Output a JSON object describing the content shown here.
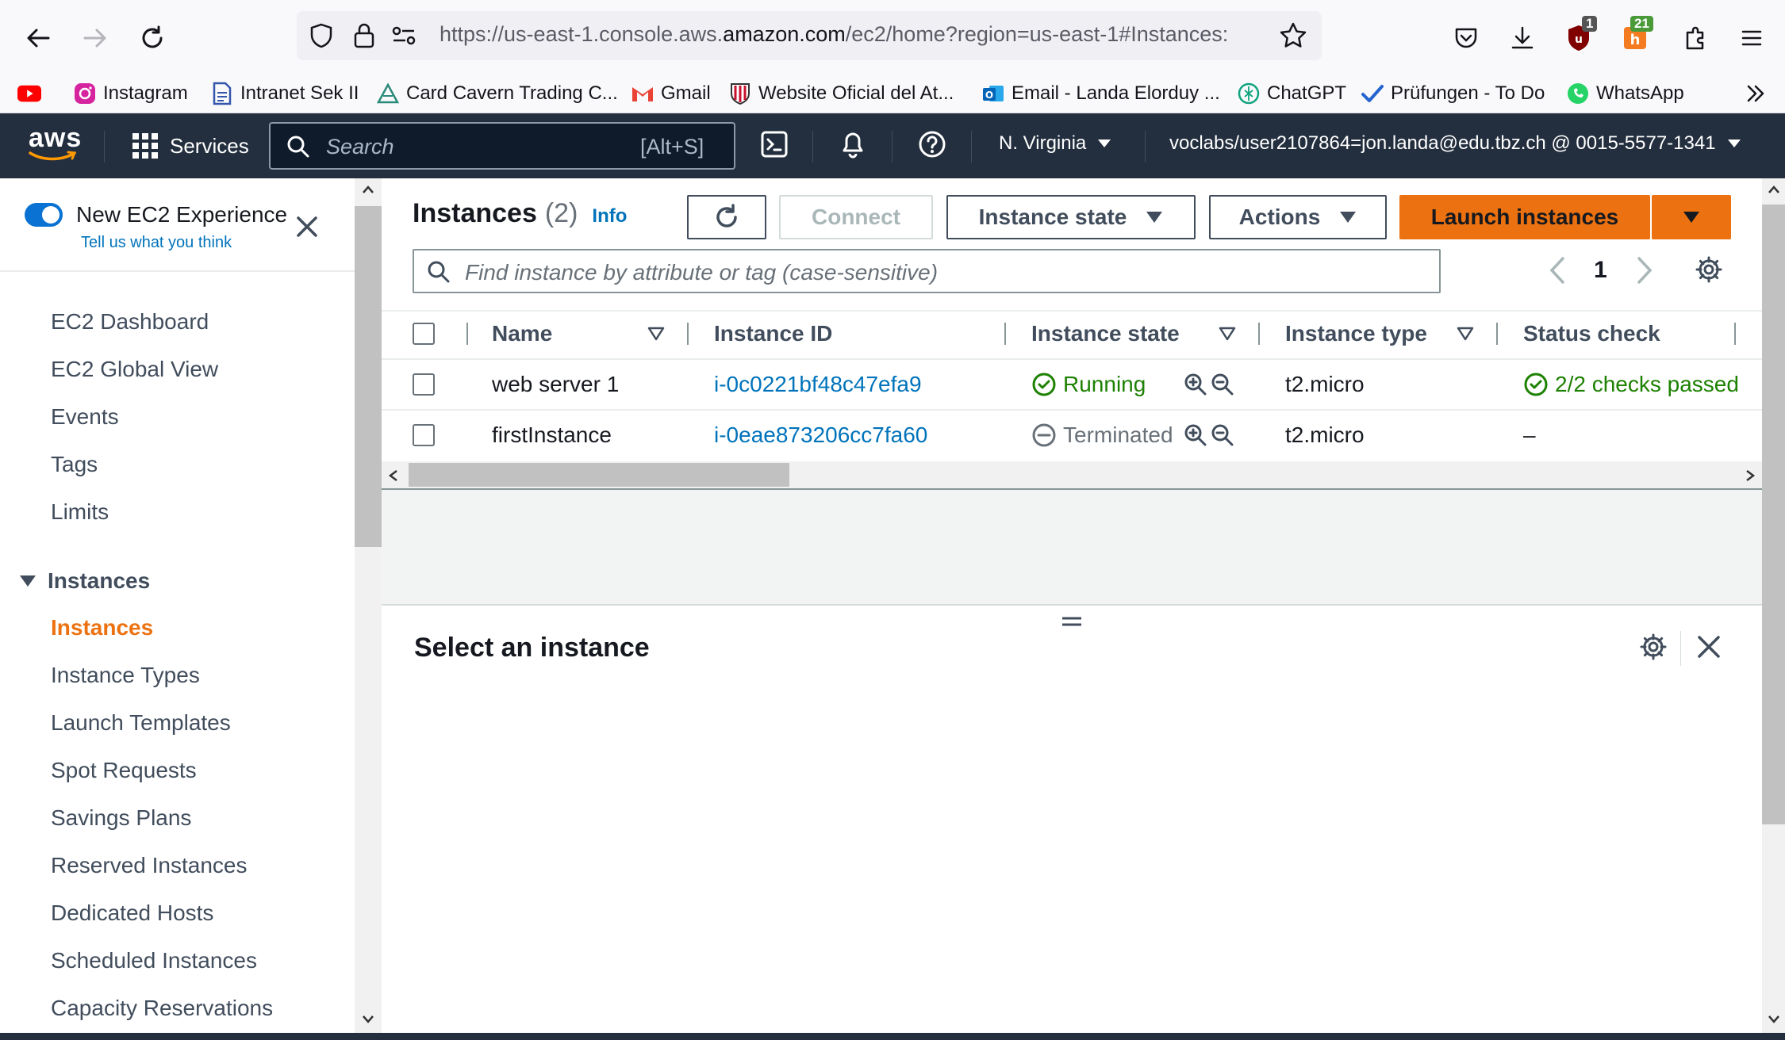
{
  "browser": {
    "url_prefix": "https://us-east-1.console.aws.",
    "url_domain": "amazon.com",
    "url_suffix": "/ec2/home?region=us-east-1#Instances:",
    "ublock_badge": "1",
    "ext_badge": "21",
    "bookmarks": [
      {
        "label": "Instagram"
      },
      {
        "label": "Intranet Sek II"
      },
      {
        "label": "Card Cavern Trading C..."
      },
      {
        "label": "Gmail"
      },
      {
        "label": "Website Oficial del At..."
      },
      {
        "label": "Email - Landa Elorduy ..."
      },
      {
        "label": "ChatGPT"
      },
      {
        "label": "Prüfungen - To Do"
      },
      {
        "label": "WhatsApp"
      }
    ]
  },
  "aws_nav": {
    "logo": "aws",
    "services": "Services",
    "search_placeholder": "Search",
    "search_shortcut": "[Alt+S]",
    "region": "N. Virginia",
    "account": "voclabs/user2107864=jon.landa@edu.tbz.ch @ 0015-5577-1341"
  },
  "sidebar": {
    "toggle_label": "New EC2 Experience",
    "feedback_link": "Tell us what you think",
    "top_items": [
      "EC2 Dashboard",
      "EC2 Global View",
      "Events",
      "Tags",
      "Limits"
    ],
    "section_title": "Instances",
    "section_items": [
      "Instances",
      "Instance Types",
      "Launch Templates",
      "Spot Requests",
      "Savings Plans",
      "Reserved Instances",
      "Dedicated Hosts",
      "Scheduled Instances",
      "Capacity Reservations"
    ],
    "active_item": "Instances"
  },
  "instances_panel": {
    "title": "Instances",
    "count": "(2)",
    "info": "Info",
    "connect": "Connect",
    "instance_state": "Instance state",
    "actions": "Actions",
    "launch": "Launch instances",
    "filter_placeholder": "Find instance by attribute or tag (case-sensitive)",
    "page": "1",
    "columns": [
      "Name",
      "Instance ID",
      "Instance state",
      "Instance type",
      "Status check"
    ],
    "rows": [
      {
        "name": "web server 1",
        "id": "i-0c0221bf48c47efa9",
        "state": "Running",
        "type": "t2.micro",
        "status": "2/2 checks passed"
      },
      {
        "name": "firstInstance",
        "id": "i-0eae873206cc7fa60",
        "state": "Terminated",
        "type": "t2.micro",
        "status": "–"
      }
    ]
  },
  "details_panel": {
    "title": "Select an instance"
  },
  "colors": {
    "aws_nav": "#232f3e",
    "accent_orange": "#ff9900",
    "link_blue": "#0073bb",
    "success_green": "#1d8102",
    "active_orange": "#ec7211"
  }
}
